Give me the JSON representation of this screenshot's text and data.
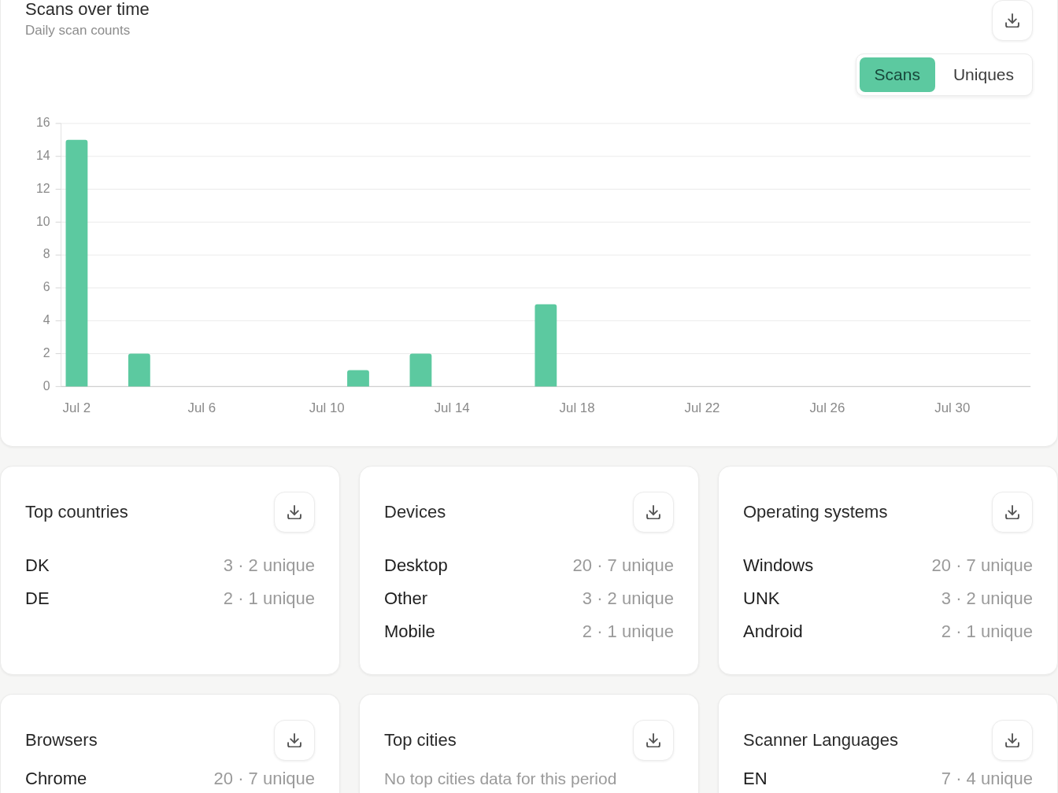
{
  "scans_over_time": {
    "title": "Scans over time",
    "subtitle": "Daily scan counts",
    "toggle": [
      {
        "label": "Scans",
        "selected": true
      },
      {
        "label": "Uniques",
        "selected": false
      }
    ],
    "chart_data": {
      "type": "bar",
      "categories": [
        "Jul 2",
        null,
        null,
        null,
        "Jul 6",
        null,
        null,
        null,
        "Jul 10",
        null,
        null,
        null,
        "Jul 14",
        null,
        null,
        null,
        "Jul 18",
        null,
        null,
        null,
        "Jul 22",
        null,
        null,
        null,
        "Jul 26",
        null,
        null,
        null,
        "Jul 30",
        null,
        null
      ],
      "values": [
        15,
        0,
        2,
        0,
        0,
        0,
        0,
        0,
        0,
        1,
        0,
        2,
        0,
        0,
        0,
        5,
        0,
        0,
        0,
        0,
        0,
        0,
        0,
        0,
        0,
        0,
        0,
        0,
        0,
        0,
        0
      ],
      "ylim": [
        0,
        16
      ],
      "yticks": [
        0,
        2,
        4,
        6,
        8,
        10,
        12,
        14,
        16
      ],
      "grid": true
    }
  },
  "panels": [
    {
      "title": "Top countries",
      "rows": [
        {
          "label": "DK",
          "value": "3 · 2 unique"
        },
        {
          "label": "DE",
          "value": "2 · 1 unique"
        }
      ]
    },
    {
      "title": "Devices",
      "rows": [
        {
          "label": "Desktop",
          "value": "20 · 7 unique"
        },
        {
          "label": "Other",
          "value": "3 · 2 unique"
        },
        {
          "label": "Mobile",
          "value": "2 · 1 unique"
        }
      ]
    },
    {
      "title": "Operating systems",
      "rows": [
        {
          "label": "Windows",
          "value": "20 · 7 unique"
        },
        {
          "label": "UNK",
          "value": "3 · 2 unique"
        },
        {
          "label": "Android",
          "value": "2 · 1 unique"
        }
      ]
    },
    {
      "title": "Browsers",
      "rows": [
        {
          "label": "Chrome",
          "value": "20 · 7 unique"
        }
      ]
    },
    {
      "title": "Top cities",
      "empty_message": "No top cities data for this period"
    },
    {
      "title": "Scanner Languages",
      "rows": [
        {
          "label": "EN",
          "value": "7 · 4 unique"
        }
      ]
    }
  ]
}
